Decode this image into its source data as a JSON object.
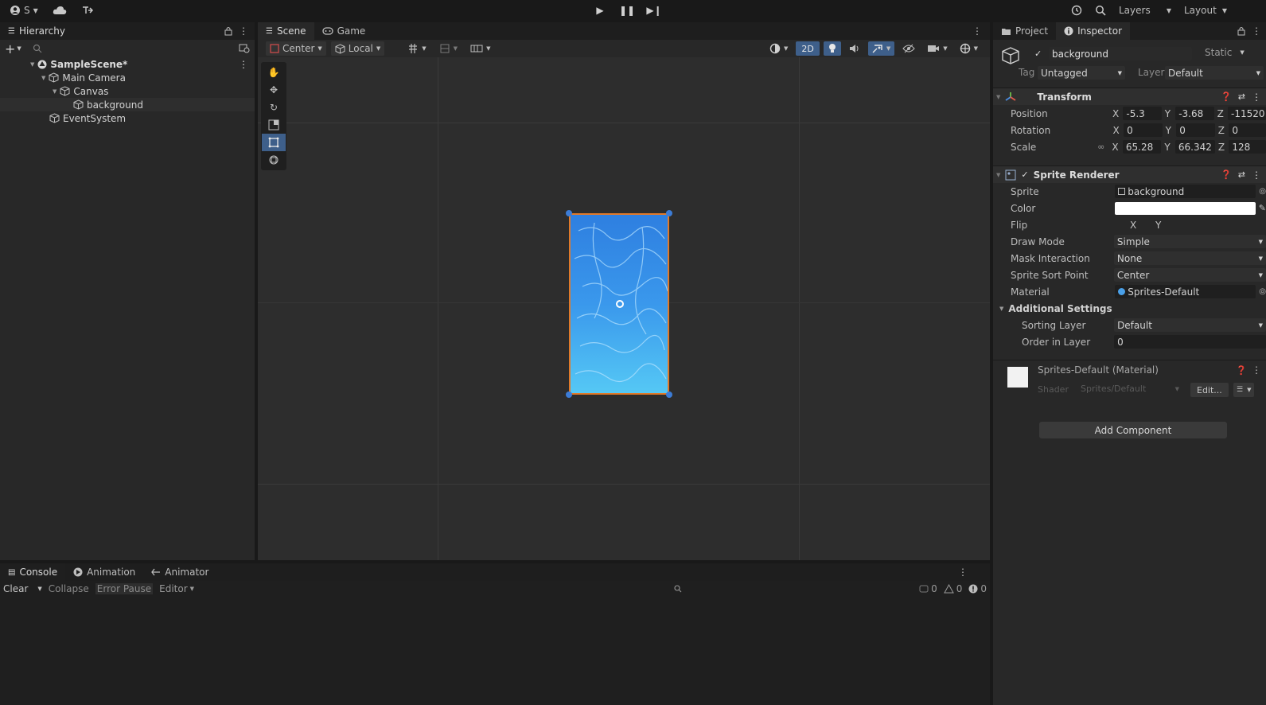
{
  "topbar": {
    "account_label": "S",
    "layers_label": "Layers",
    "layout_label": "Layout"
  },
  "hierarchy": {
    "tab_label": "Hierarchy",
    "items": [
      {
        "label": "SampleScene*",
        "depth": 0
      },
      {
        "label": "Main Camera",
        "depth": 1
      },
      {
        "label": "Canvas",
        "depth": 2
      },
      {
        "label": "background",
        "depth": 3
      },
      {
        "label": "EventSystem",
        "depth": 1
      }
    ]
  },
  "scene": {
    "tab_scene": "Scene",
    "tab_game": "Game",
    "pivot_label": "Center",
    "space_label": "Local",
    "mode_2d_label": "2D"
  },
  "inspector": {
    "tab_project": "Project",
    "tab_inspector": "Inspector",
    "object_name": "background",
    "static_label": "Static",
    "tag_label": "Tag",
    "tag_value": "Untagged",
    "layer_label": "Layer",
    "layer_value": "Default",
    "transform": {
      "title": "Transform",
      "position_label": "Position",
      "rotation_label": "Rotation",
      "scale_label": "Scale",
      "axis_x": "X",
      "axis_y": "Y",
      "axis_z": "Z",
      "position": {
        "x": "-5.3",
        "y": "-3.68",
        "z": "-11520"
      },
      "rotation": {
        "x": "0",
        "y": "0",
        "z": "0"
      },
      "scale": {
        "x": "65.28",
        "y": "66.342",
        "z": "128"
      }
    },
    "sprite_renderer": {
      "title": "Sprite Renderer",
      "sprite_label": "Sprite",
      "sprite_value": "background",
      "color_label": "Color",
      "color_value": "#ffffff",
      "flip_label": "Flip",
      "flip_x": "X",
      "flip_y": "Y",
      "draw_mode_label": "Draw Mode",
      "draw_mode_value": "Simple",
      "mask_label": "Mask Interaction",
      "mask_value": "None",
      "sort_point_label": "Sprite Sort Point",
      "sort_point_value": "Center",
      "material_label": "Material",
      "material_value": "Sprites-Default",
      "additional_label": "Additional Settings",
      "sorting_layer_label": "Sorting Layer",
      "sorting_layer_value": "Default",
      "order_label": "Order in Layer",
      "order_value": "0"
    },
    "material": {
      "title": "Sprites-Default (Material)",
      "shader_label": "Shader",
      "shader_value": "Sprites/Default",
      "edit_label": "Edit..."
    },
    "add_component_label": "Add Component"
  },
  "console": {
    "tab_console": "Console",
    "tab_animation": "Animation",
    "tab_animator": "Animator",
    "clear_label": "Clear",
    "collapse_label": "Collapse",
    "error_pause_label": "Error Pause",
    "editor_label": "Editor",
    "log_count": "0",
    "warn_count": "0",
    "error_count": "0"
  },
  "colors": {
    "accent": "#3e5f8a",
    "selection": "#2c5d87",
    "sprite_top": "#2e7fe0",
    "sprite_bottom": "#55c8f5",
    "sprite_border": "#e07a2a"
  }
}
